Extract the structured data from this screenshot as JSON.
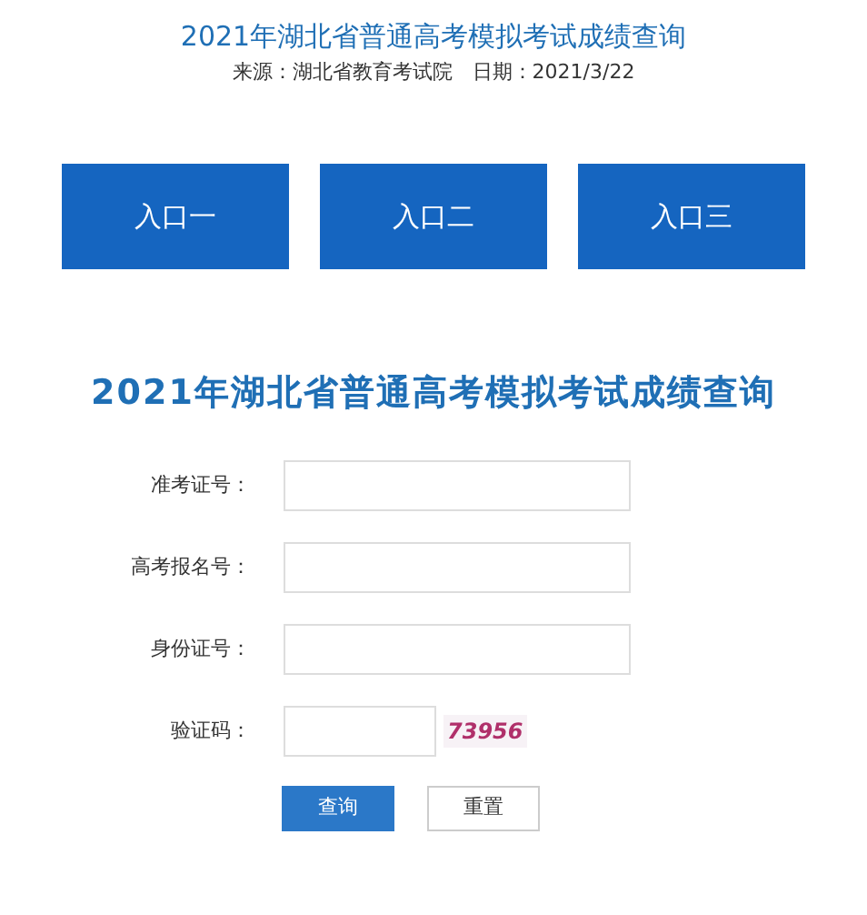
{
  "article": {
    "title": "2021年湖北省普通高考模拟考试成绩查询",
    "meta": "来源：湖北省教育考试院　日期：2021/3/22"
  },
  "entries": [
    "入口一",
    "入口二",
    "入口三"
  ],
  "form": {
    "heading": "2021年湖北省普通高考模拟考试成绩查询",
    "fields": [
      {
        "label": "准考证号：",
        "kind": "text"
      },
      {
        "label": "高考报名号：",
        "kind": "text"
      },
      {
        "label": "身份证号：",
        "kind": "text"
      },
      {
        "label": "验证码：",
        "kind": "captcha",
        "captcha": "73956"
      }
    ],
    "buttons": [
      {
        "label": "查询",
        "kind": "primary"
      },
      {
        "label": "重置",
        "kind": "secondary"
      }
    ]
  }
}
